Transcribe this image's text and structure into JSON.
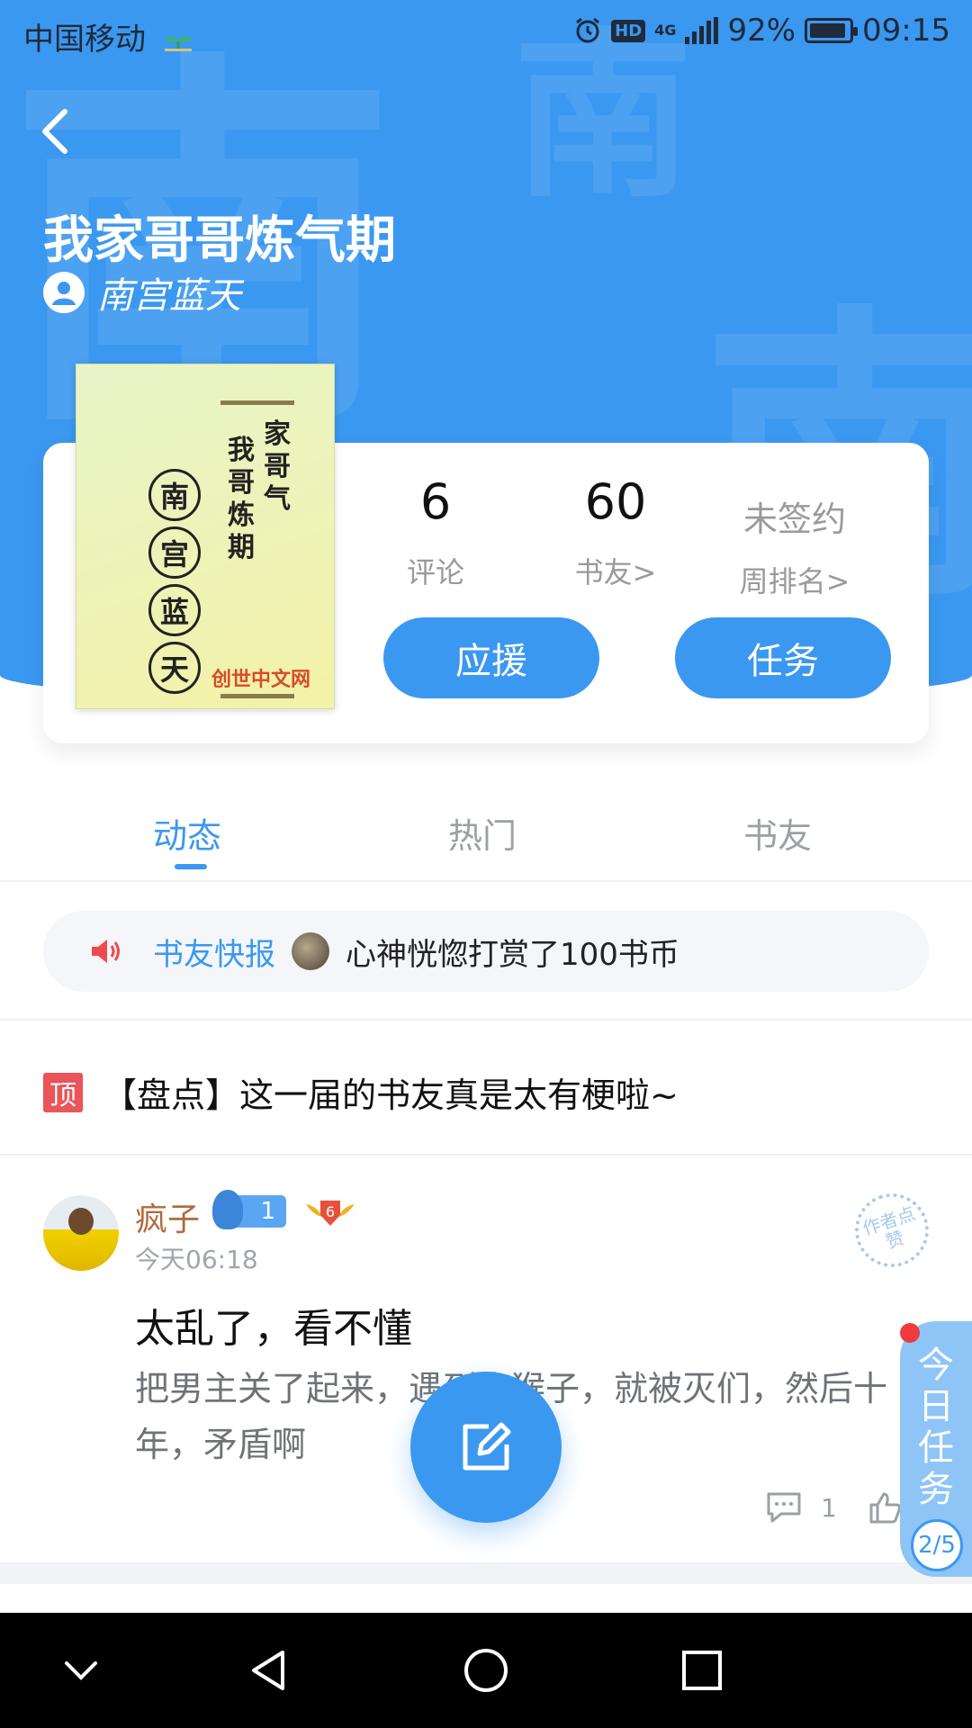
{
  "status_bar": {
    "carrier": "中国移动",
    "network": "4G",
    "hd": "HD",
    "battery": "92%",
    "battery_level": 0.92,
    "time": "09:15"
  },
  "book": {
    "title": "我家哥哥炼气期",
    "author": "南宫蓝天",
    "cover": {
      "title_col_right": "家哥气",
      "title_col_left": "我哥炼期",
      "author_chars": [
        "南",
        "宫",
        "蓝",
        "天"
      ],
      "brand": "创世中文网"
    },
    "watermark_char": "南"
  },
  "stats": {
    "comments": {
      "value": "6",
      "label": "评论"
    },
    "readers": {
      "value": "60",
      "label": "书友>"
    },
    "contract": {
      "value": "未签约",
      "label": "周排名>"
    }
  },
  "buttons": {
    "support": "应援",
    "tasks": "任务"
  },
  "tabs": [
    {
      "label": "动态",
      "active": true
    },
    {
      "label": "热门",
      "active": false
    },
    {
      "label": "书友",
      "active": false
    }
  ],
  "news": {
    "label": "书友快报",
    "text": "心神恍惚打赏了100书币"
  },
  "pinned": {
    "badge": "顶",
    "title": "【盘点】这一届的书友真是太有梗啦~"
  },
  "post": {
    "username": "疯子",
    "fan_level": "1",
    "rank_level": "6",
    "time": "今天06:18",
    "stamp": "作者点赞",
    "title": "太乱了，看不懂",
    "body": "把男主关了起来，遇到小猴子，就被灭们，然后十年，矛盾啊",
    "reply_count": "1"
  },
  "task_widget": {
    "label": "今日任务",
    "progress": "2/5"
  },
  "colors": {
    "brand_blue": "#3b98f0",
    "username_brown": "#b06a3a",
    "pin_red": "#e9555a"
  }
}
